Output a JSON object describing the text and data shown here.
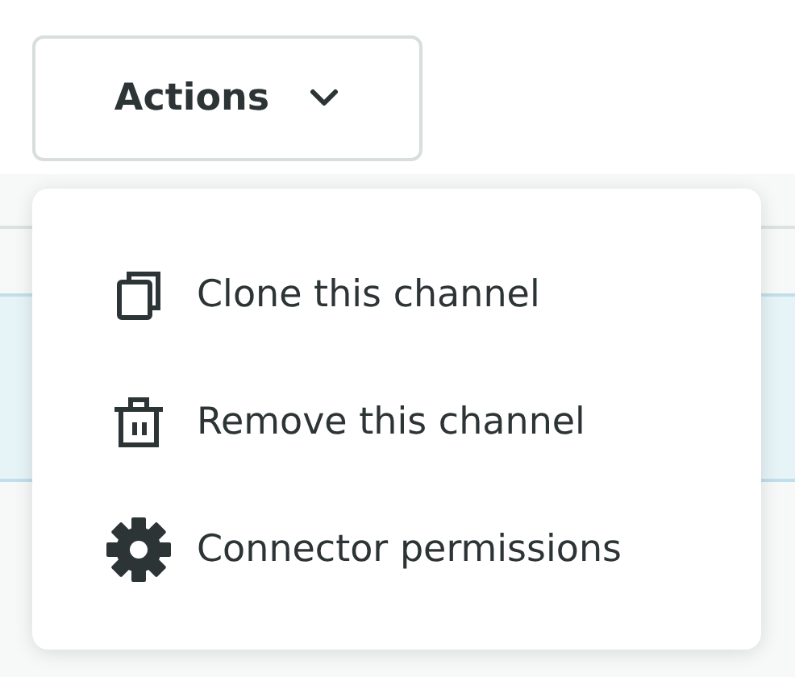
{
  "actions_button": {
    "label": "Actions",
    "expanded": true
  },
  "menu_items": [
    {
      "kind": "clone",
      "label": "Clone this channel"
    },
    {
      "kind": "remove",
      "label": "Remove this channel"
    },
    {
      "kind": "settings",
      "label": "Connector permissions"
    }
  ]
}
